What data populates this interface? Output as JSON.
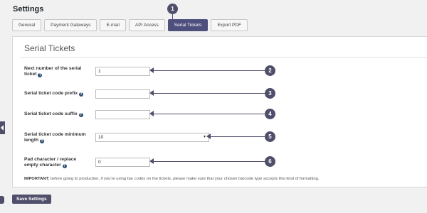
{
  "header": {
    "title": "Settings"
  },
  "tabs": [
    {
      "label": "General"
    },
    {
      "label": "Payment Gateways"
    },
    {
      "label": "E-mail"
    },
    {
      "label": "API Access"
    },
    {
      "label": "Serial Tickets"
    },
    {
      "label": "Export PDF"
    }
  ],
  "card": {
    "title": "Serial Tickets",
    "fields": [
      {
        "label_line1": "Next number of the serial",
        "label_line2": "ticket",
        "value": "1",
        "badge": "2"
      },
      {
        "label": "Serial ticket code prefix",
        "value": "",
        "badge": "3"
      },
      {
        "label": "Serial ticket code suffix",
        "value": "",
        "badge": "4"
      },
      {
        "label_line1": "Serial ticket code minimum",
        "label_line2": "length",
        "value": "10",
        "badge": "5"
      },
      {
        "label_line1": "Pad character / replace",
        "label_line2": "empty character",
        "value": "0",
        "badge": "6"
      }
    ],
    "note_strong": "IMPORTANT:",
    "note_text": "before going to production, if you're using bar codes on the tickets, please make sure that your chosen barcode type accepts this kind of formatting."
  },
  "top_badge": "1",
  "save_label": "Save Settings",
  "icons": {
    "help": "?",
    "caret": "▾"
  },
  "colors": {
    "accent": "#4f4f6b",
    "active_tab": "#4f4f7d",
    "help_icon": "#2d4d73"
  }
}
